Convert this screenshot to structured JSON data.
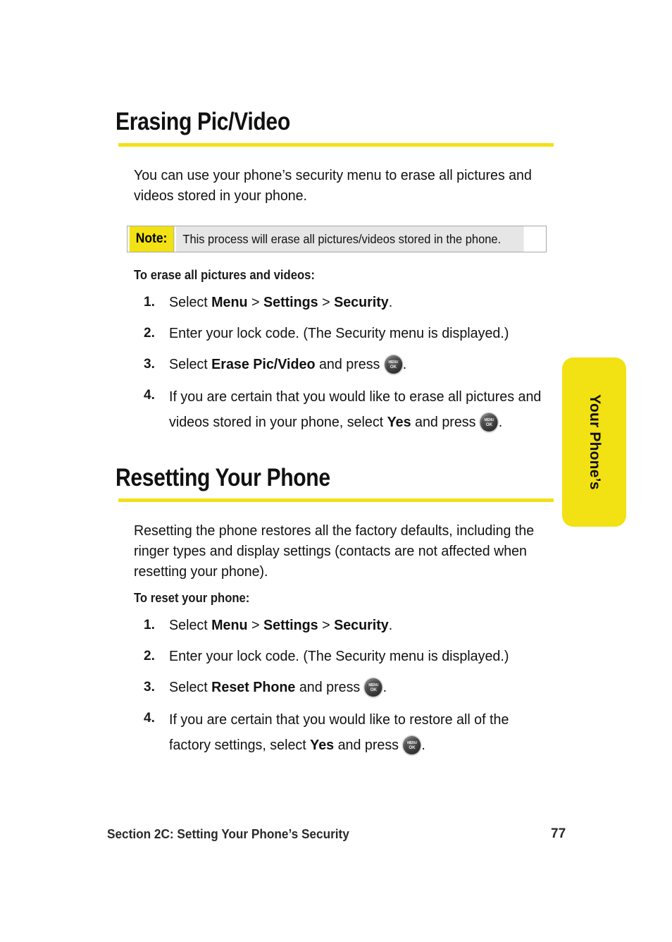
{
  "page": {
    "number": "77",
    "footer_section": "Section 2C: Setting Your Phone’s Security",
    "accent_yellow": "#F2E113",
    "note_bg": "#E6E6E6",
    "text_color": "#111111"
  },
  "side_tab": {
    "label": "Your Phone’s"
  },
  "sections": [
    {
      "heading": "Erasing Pic/Video",
      "intro": "You can use your phone’s security menu to erase all pictures and videos stored in your phone.",
      "note": {
        "label": "Note:",
        "text": "This process will erase all pictures/videos stored in the phone."
      },
      "sub_heading": "To erase all pictures and videos:",
      "steps": [
        {
          "num": "1.",
          "parts": [
            {
              "t": "Select ",
              "b": false
            },
            {
              "t": "Menu",
              "b": true
            },
            {
              "t": " > ",
              "b": false
            },
            {
              "t": "Settings",
              "b": true
            },
            {
              "t": " > ",
              "b": false
            },
            {
              "t": "Security",
              "b": true
            },
            {
              "t": ".",
              "b": false
            }
          ]
        },
        {
          "num": "2.",
          "parts": [
            {
              "t": "Enter your lock code. (The Security menu is displayed.)",
              "b": false
            }
          ]
        },
        {
          "num": "3.",
          "parts": [
            {
              "t": "Select ",
              "b": false
            },
            {
              "t": "Erase Pic/Video",
              "b": true
            },
            {
              "t": " and press ",
              "b": false
            },
            {
              "key": "menu-ok-key"
            },
            {
              "t": ".",
              "b": false
            }
          ]
        },
        {
          "num": "4.",
          "loose": true,
          "parts": [
            {
              "t": "If you are certain that you would like to erase all pictures and videos stored in your phone, select ",
              "b": false
            },
            {
              "t": "Yes",
              "b": true
            },
            {
              "t": " and press ",
              "b": false
            },
            {
              "key": "menu-ok-key"
            },
            {
              "t": ".",
              "b": false
            }
          ]
        }
      ]
    },
    {
      "heading": "Resetting Your Phone",
      "intro": "Resetting the phone restores all the factory defaults, including the ringer types and display settings (contacts are not affected when resetting your phone).",
      "sub_heading": "To reset your phone:",
      "steps": [
        {
          "num": "1.",
          "parts": [
            {
              "t": "Select ",
              "b": false
            },
            {
              "t": "Menu",
              "b": true
            },
            {
              "t": " > ",
              "b": false
            },
            {
              "t": "Settings",
              "b": true
            },
            {
              "t": " > ",
              "b": false
            },
            {
              "t": "Security",
              "b": true
            },
            {
              "t": ".",
              "b": false
            }
          ]
        },
        {
          "num": "2.",
          "parts": [
            {
              "t": "Enter your lock code. (The Security menu is displayed.)",
              "b": false
            }
          ]
        },
        {
          "num": "3.",
          "parts": [
            {
              "t": "Select ",
              "b": false
            },
            {
              "t": "Reset Phone",
              "b": true
            },
            {
              "t": " and press ",
              "b": false
            },
            {
              "key": "menu-ok-key"
            },
            {
              "t": ".",
              "b": false
            }
          ]
        },
        {
          "num": "4.",
          "loose": true,
          "parts": [
            {
              "t": "If you are certain that you would like to restore all of the factory settings, select ",
              "b": false
            },
            {
              "t": "Yes",
              "b": true
            },
            {
              "t": " and press ",
              "b": false
            },
            {
              "key": "menu-ok-key"
            },
            {
              "t": ".",
              "b": false
            }
          ]
        }
      ]
    }
  ],
  "icons": {
    "menu_ok_key": {
      "name": "menu-ok-key",
      "line1": "MENU",
      "line2": "OK"
    }
  }
}
